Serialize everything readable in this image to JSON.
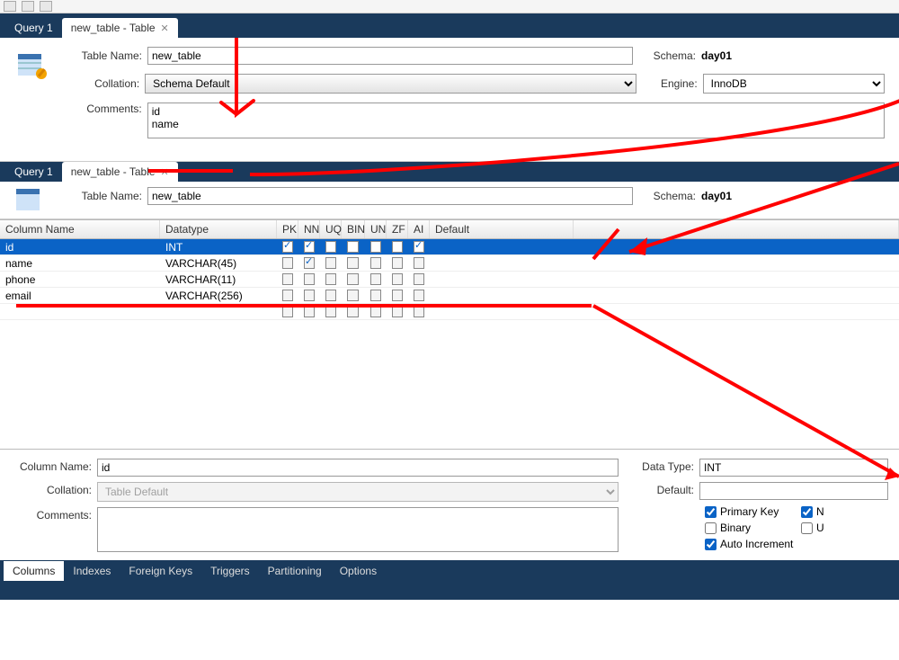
{
  "toolbar": {
    "icons": [
      "sql-icon",
      "exec-icon",
      "search-icon"
    ]
  },
  "tabs_top": {
    "query_label": "Query 1",
    "table_tab_label": "new_table - Table"
  },
  "form_top": {
    "table_name_label": "Table Name:",
    "table_name_value": "new_table",
    "schema_label": "Schema:",
    "schema_value": "day01",
    "collation_label": "Collation:",
    "collation_value": "Schema Default",
    "engine_label": "Engine:",
    "engine_value": "InnoDB",
    "comments_label": "Comments:",
    "comments_value": "id\nname"
  },
  "mid_header": {
    "table_name_label": "Table Name:",
    "table_name_value": "new_table",
    "schema_label": "Schema:",
    "schema_value": "day01"
  },
  "grid": {
    "headers": {
      "colname": "Column Name",
      "datatype": "Datatype",
      "pk": "PK",
      "nn": "NN",
      "uq": "UQ",
      "bin": "BIN",
      "un": "UN",
      "zf": "ZF",
      "ai": "AI",
      "default": "Default"
    },
    "rows": [
      {
        "name": "id",
        "datatype": "INT",
        "pk": true,
        "nn": true,
        "uq": false,
        "bin": false,
        "un": false,
        "zf": false,
        "ai": true,
        "default": "",
        "selected": true
      },
      {
        "name": "name",
        "datatype": "VARCHAR(45)",
        "pk": false,
        "nn": true,
        "uq": false,
        "bin": false,
        "un": false,
        "zf": false,
        "ai": false,
        "default": ""
      },
      {
        "name": "phone",
        "datatype": "VARCHAR(11)",
        "pk": false,
        "nn": false,
        "uq": false,
        "bin": false,
        "un": false,
        "zf": false,
        "ai": false,
        "default": ""
      },
      {
        "name": "email",
        "datatype": "VARCHAR(256)",
        "pk": false,
        "nn": false,
        "uq": false,
        "bin": false,
        "un": false,
        "zf": false,
        "ai": false,
        "default": ""
      }
    ]
  },
  "detail": {
    "colname_label": "Column Name:",
    "colname_value": "id",
    "datatype_label": "Data Type:",
    "datatype_value": "INT",
    "collation_label": "Collation:",
    "collation_value": "Table Default",
    "default_label": "Default:",
    "default_value": "",
    "comments_label": "Comments:",
    "comments_value": "",
    "chk_primary": "Primary Key",
    "chk_notnull_short": "N",
    "chk_binary": "Binary",
    "chk_unsigned_short": "U",
    "chk_autoinc": "Auto Increment",
    "pk_on": true,
    "nn_on": true,
    "bin_on": false,
    "un_on": false,
    "ai_on": true
  },
  "bottom_tabs": {
    "columns": "Columns",
    "indexes": "Indexes",
    "fks": "Foreign Keys",
    "triggers": "Triggers",
    "partitioning": "Partitioning",
    "options": "Options"
  }
}
